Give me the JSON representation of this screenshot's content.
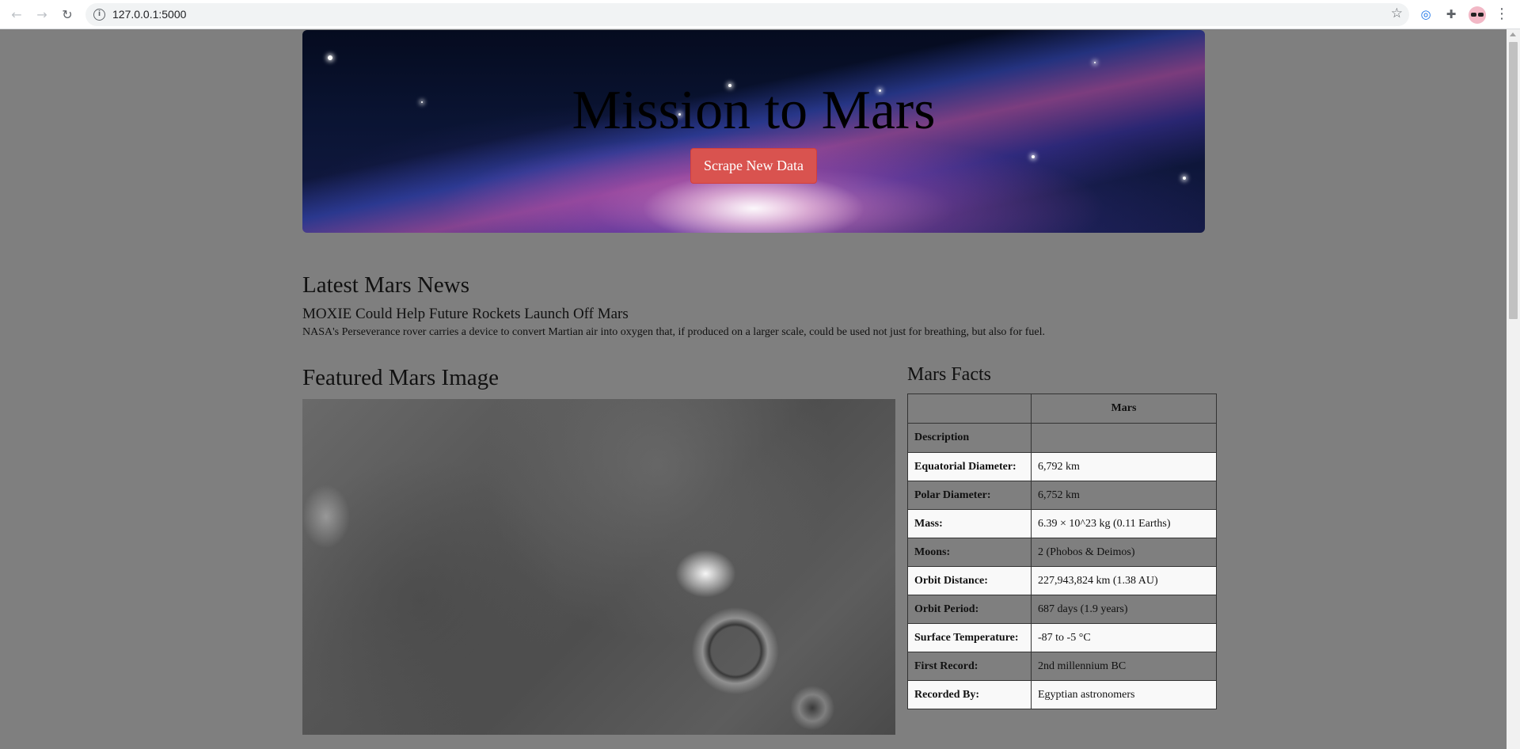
{
  "browser": {
    "url": "127.0.0.1:5000",
    "back_icon": "arrow-left",
    "forward_icon": "arrow-right",
    "reload_icon": "reload",
    "info_icon": "info",
    "bookmark_icon": "star",
    "extension_icon": "puzzle",
    "menu_icon": "vertical-dots"
  },
  "hero": {
    "title": "Mission to Mars",
    "button_label": "Scrape New Data",
    "button_color": "#d9534f"
  },
  "news": {
    "heading": "Latest Mars News",
    "title": "MOXIE Could Help Future Rockets Launch Off Mars",
    "paragraph": "NASA's Perseverance rover carries a device to convert Martian air into oxygen that, if produced on a larger scale, could be used not just for breathing, but also for fuel."
  },
  "featured": {
    "heading": "Featured Mars Image"
  },
  "facts": {
    "heading": "Mars Facts",
    "column_header": "Mars",
    "index_header": "Description",
    "rows": [
      {
        "label": "Equatorial Diameter:",
        "value": "6,792 km"
      },
      {
        "label": "Polar Diameter:",
        "value": "6,752 km"
      },
      {
        "label": "Mass:",
        "value": "6.39 × 10^23 kg (0.11 Earths)"
      },
      {
        "label": "Moons:",
        "value": "2 (Phobos & Deimos)"
      },
      {
        "label": "Orbit Distance:",
        "value": "227,943,824 km (1.38 AU)"
      },
      {
        "label": "Orbit Period:",
        "value": "687 days (1.9 years)"
      },
      {
        "label": "Surface Temperature:",
        "value": "-87 to -5 °C"
      },
      {
        "label": "First Record:",
        "value": "2nd millennium BC"
      },
      {
        "label": "Recorded By:",
        "value": "Egyptian astronomers"
      }
    ]
  }
}
